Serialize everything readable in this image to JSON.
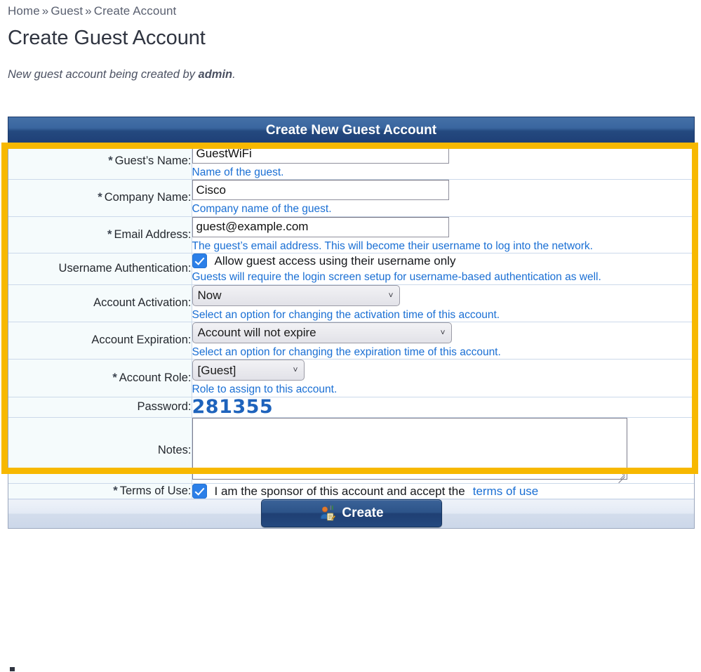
{
  "breadcrumb": {
    "items": [
      "Home",
      "Guest",
      "Create Account"
    ],
    "separator": "»"
  },
  "page_title": "Create Guest Account",
  "subtitle": {
    "prefix": "New guest account being created by ",
    "actor": "admin",
    "suffix": "."
  },
  "panel": {
    "header": "Create New Guest Account",
    "required_marker": "*"
  },
  "fields": {
    "guest_name": {
      "label": "Guest’s Name:",
      "required": true,
      "value": "GuestWiFi",
      "placeholder": "",
      "hint": "Name of the guest."
    },
    "company_name": {
      "label": "Company Name:",
      "required": true,
      "value": "Cisco",
      "placeholder": "",
      "hint": "Company name of the guest."
    },
    "email_address": {
      "label": "Email Address:",
      "required": true,
      "value": "guest@example.com",
      "placeholder": "",
      "hint": "The guest’s email address. This will become their username to log into the network."
    },
    "username_authentication": {
      "label": "Username Authentication:",
      "required": false,
      "checkbox_label": "Allow guest access using their username only",
      "checked": true,
      "hint": "Guests will require the login screen setup for username-based authentication as well."
    },
    "account_activation": {
      "label": "Account Activation:",
      "required": false,
      "selected": "Now",
      "options": [
        "Now"
      ],
      "hint": "Select an option for changing the activation time of this account."
    },
    "account_expiration": {
      "label": "Account Expiration:",
      "required": false,
      "selected": "Account will not expire",
      "options": [
        "Account will not expire"
      ],
      "hint": "Select an option for changing the expiration time of this account."
    },
    "account_role": {
      "label": "Account Role:",
      "required": true,
      "selected": "[Guest]",
      "options": [
        "[Guest]"
      ],
      "hint": "Role to assign to this account."
    },
    "password": {
      "label": "Password:",
      "required": false,
      "value": "281355"
    },
    "notes": {
      "label": "Notes:",
      "required": false,
      "value": "",
      "placeholder": ""
    },
    "terms_of_use": {
      "label": "Terms of Use:",
      "required": true,
      "checked": true,
      "text_before": "I am the sponsor of this account and accept the ",
      "link_text": "terms of use"
    }
  },
  "footer": {
    "create_label": "Create",
    "create_icon": "user-create-icon"
  },
  "icons": {
    "chevron_down": "˅"
  },
  "colors": {
    "highlight_border": "#f7b800",
    "header_blue": "#24497f",
    "hint_blue": "#1a6fd4",
    "password_blue": "#1e63bc",
    "checkbox_blue": "#2b7fe8",
    "label_cell_bg": "#f5fbfc"
  }
}
